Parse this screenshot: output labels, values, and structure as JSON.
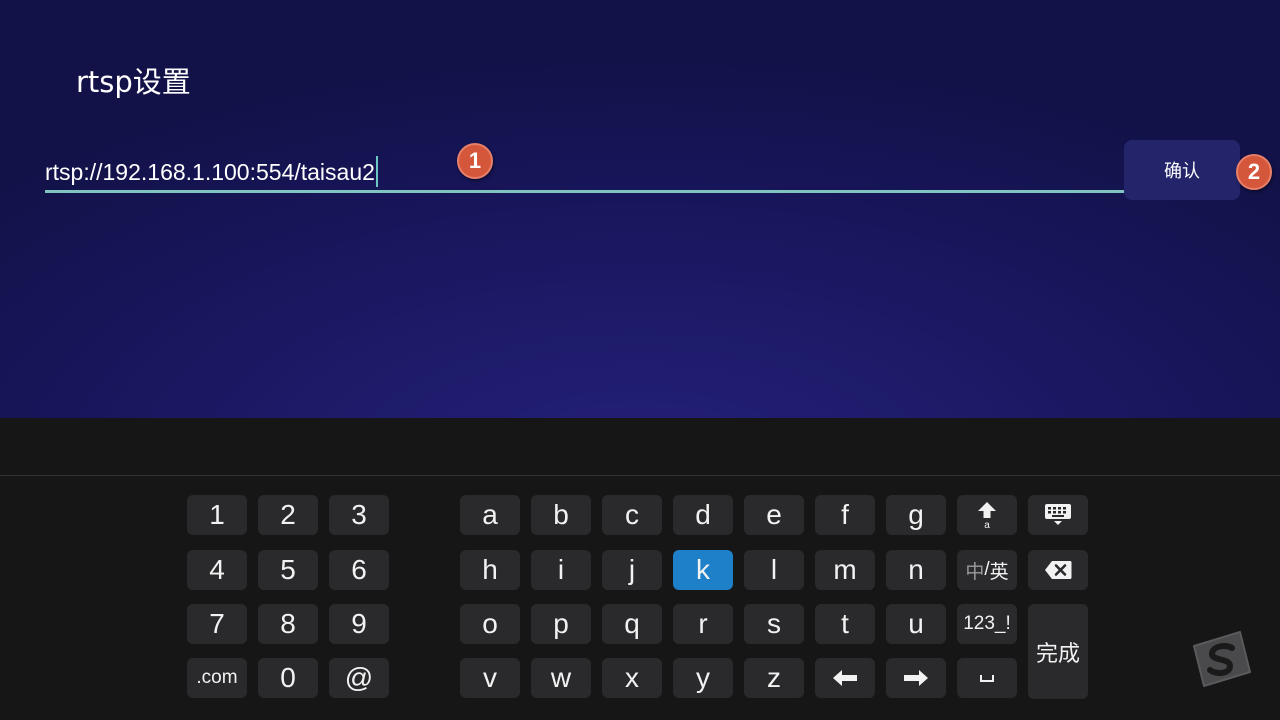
{
  "page": {
    "title": "rtsp设置",
    "url_input": {
      "value": "rtsp://192.168.1.100:554/taisau2"
    },
    "confirm_label": "确认",
    "markers": [
      "1",
      "2"
    ]
  },
  "keyboard": {
    "numpad": [
      "1",
      "2",
      "3",
      "4",
      "5",
      "6",
      "7",
      "8",
      "9",
      ".com",
      "0",
      "@"
    ],
    "row1": [
      "a",
      "b",
      "c",
      "d",
      "e",
      "f",
      "g"
    ],
    "row2": [
      "h",
      "i",
      "j",
      "k",
      "l",
      "m",
      "n"
    ],
    "row3": [
      "o",
      "p",
      "q",
      "r",
      "s",
      "t",
      "u"
    ],
    "row4": [
      "v",
      "w",
      "x",
      "y",
      "z"
    ],
    "active_key": "k",
    "lang_toggle": {
      "zh": "中",
      "sep": "/",
      "en": "英"
    },
    "symbols_label": "123_!",
    "done_label": "完成",
    "shift_sub": "a"
  },
  "colors": {
    "accent_underline": "#7fc4c0",
    "active_key": "#1e80c8",
    "marker": "#d5573b"
  },
  "icons": [
    "shift-icon",
    "keyboard-hide-icon",
    "backspace-icon",
    "arrow-left-icon",
    "arrow-right-icon",
    "space-icon",
    "watermark-logo"
  ]
}
